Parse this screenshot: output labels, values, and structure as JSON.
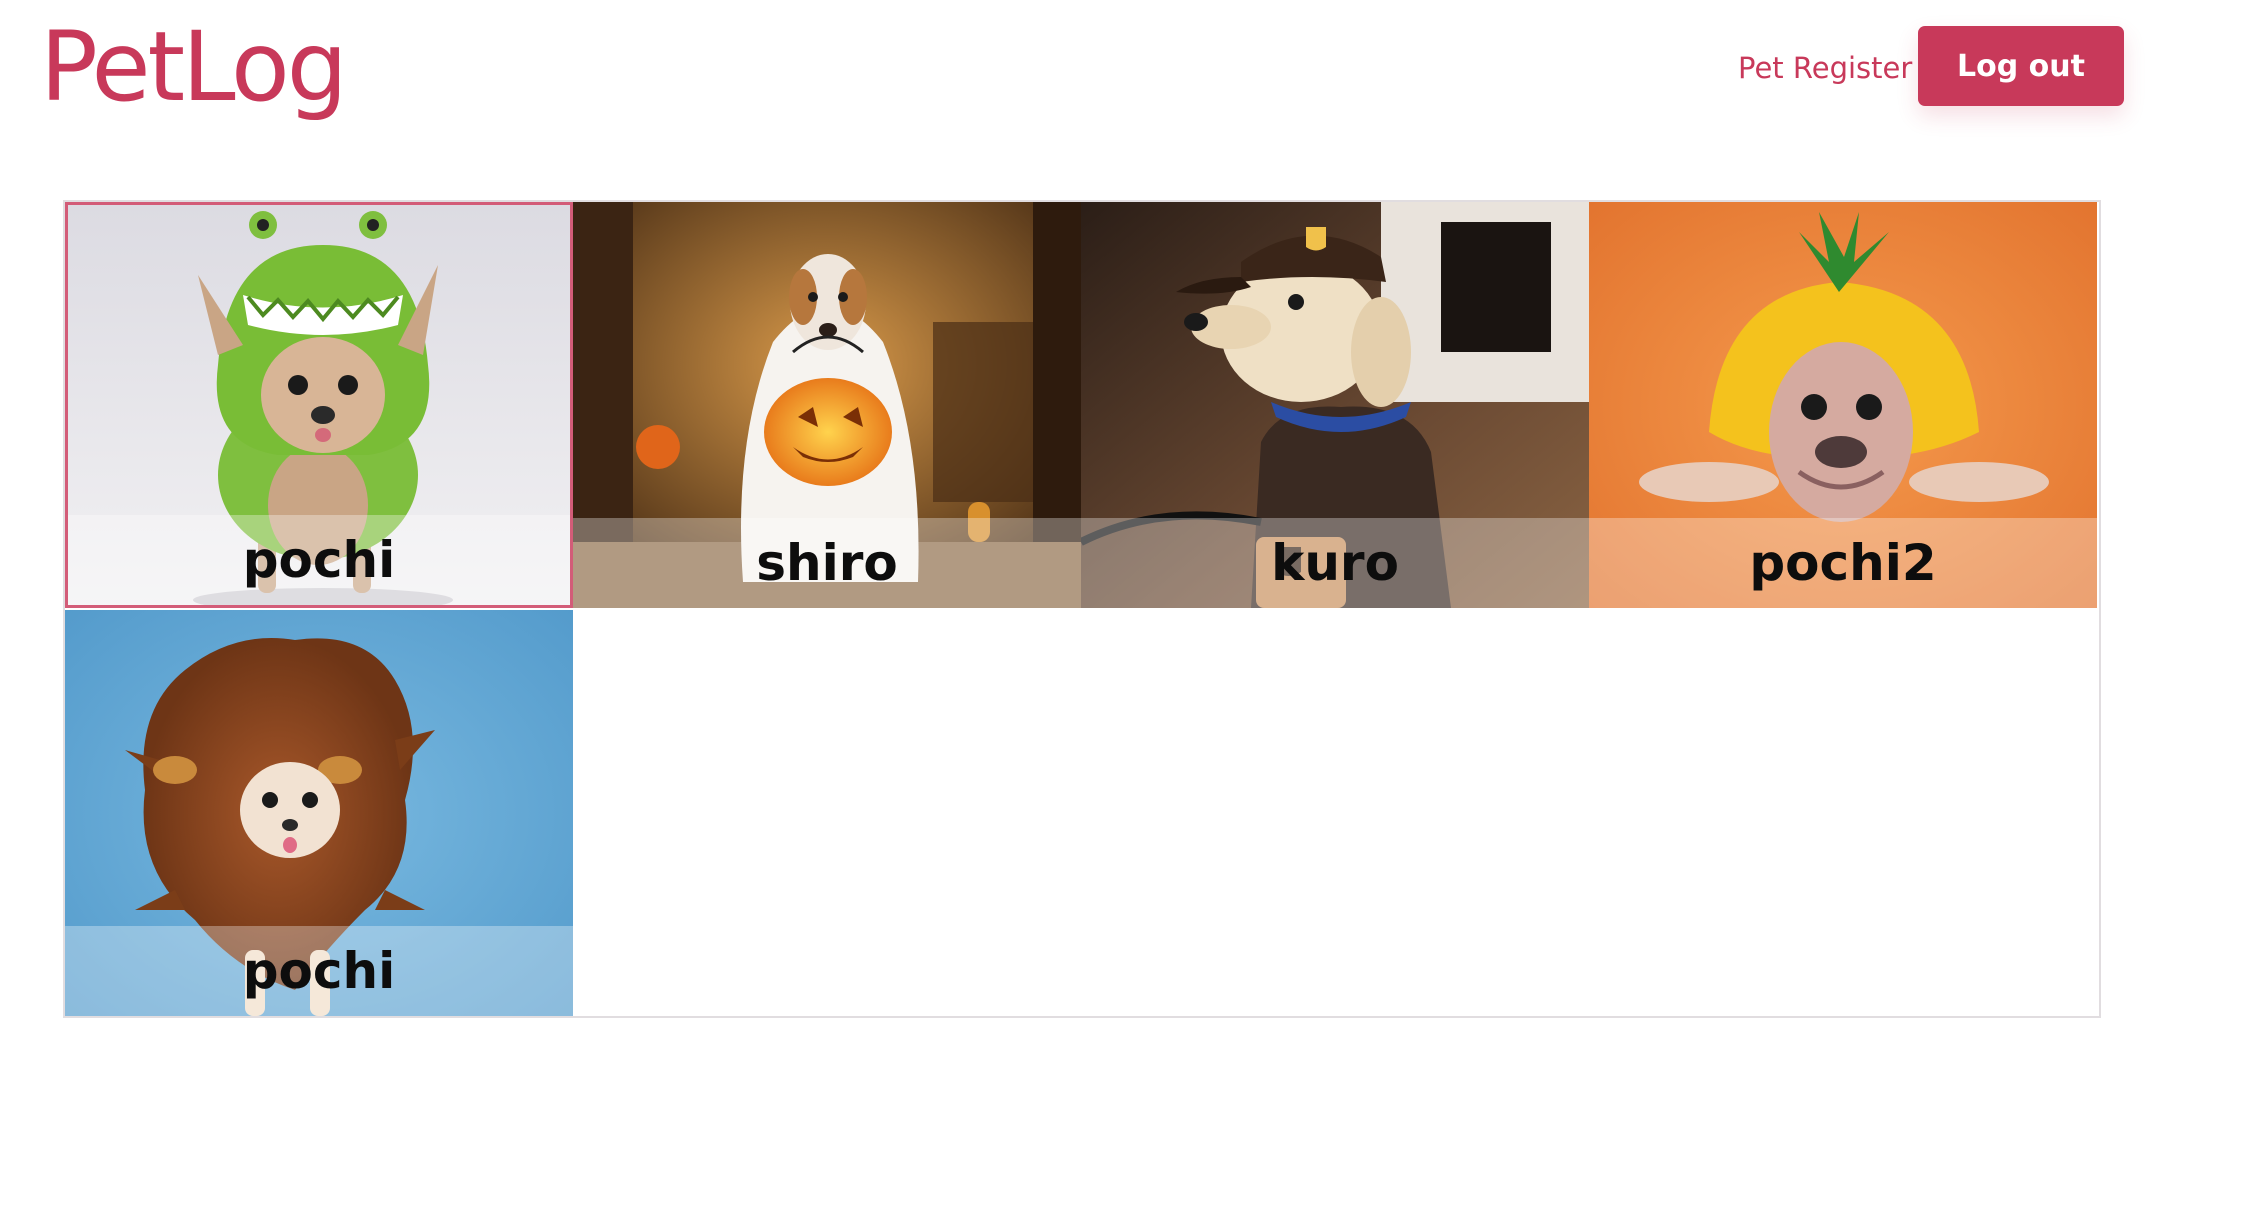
{
  "header": {
    "logo": "PetLog",
    "nav_link": "Pet Register",
    "logout_label": "Log out"
  },
  "pets": [
    {
      "name": "pochi",
      "icon": "dog-frog-costume-icon",
      "background": "#e8e7ec",
      "selected": true
    },
    {
      "name": "shiro",
      "icon": "dog-ghost-costume-icon",
      "background": "#5a3a1c",
      "selected": false
    },
    {
      "name": "kuro",
      "icon": "dog-delivery-costume-icon",
      "background": "#4a3426",
      "selected": false
    },
    {
      "name": "pochi2",
      "icon": "dog-pineapple-costume-icon",
      "background": "#f08a3d",
      "selected": false
    },
    {
      "name": "pochi",
      "icon": "dog-lion-costume-icon",
      "background": "#5fa6d4",
      "selected": false
    }
  ],
  "colors": {
    "brand": "#c8395a"
  }
}
